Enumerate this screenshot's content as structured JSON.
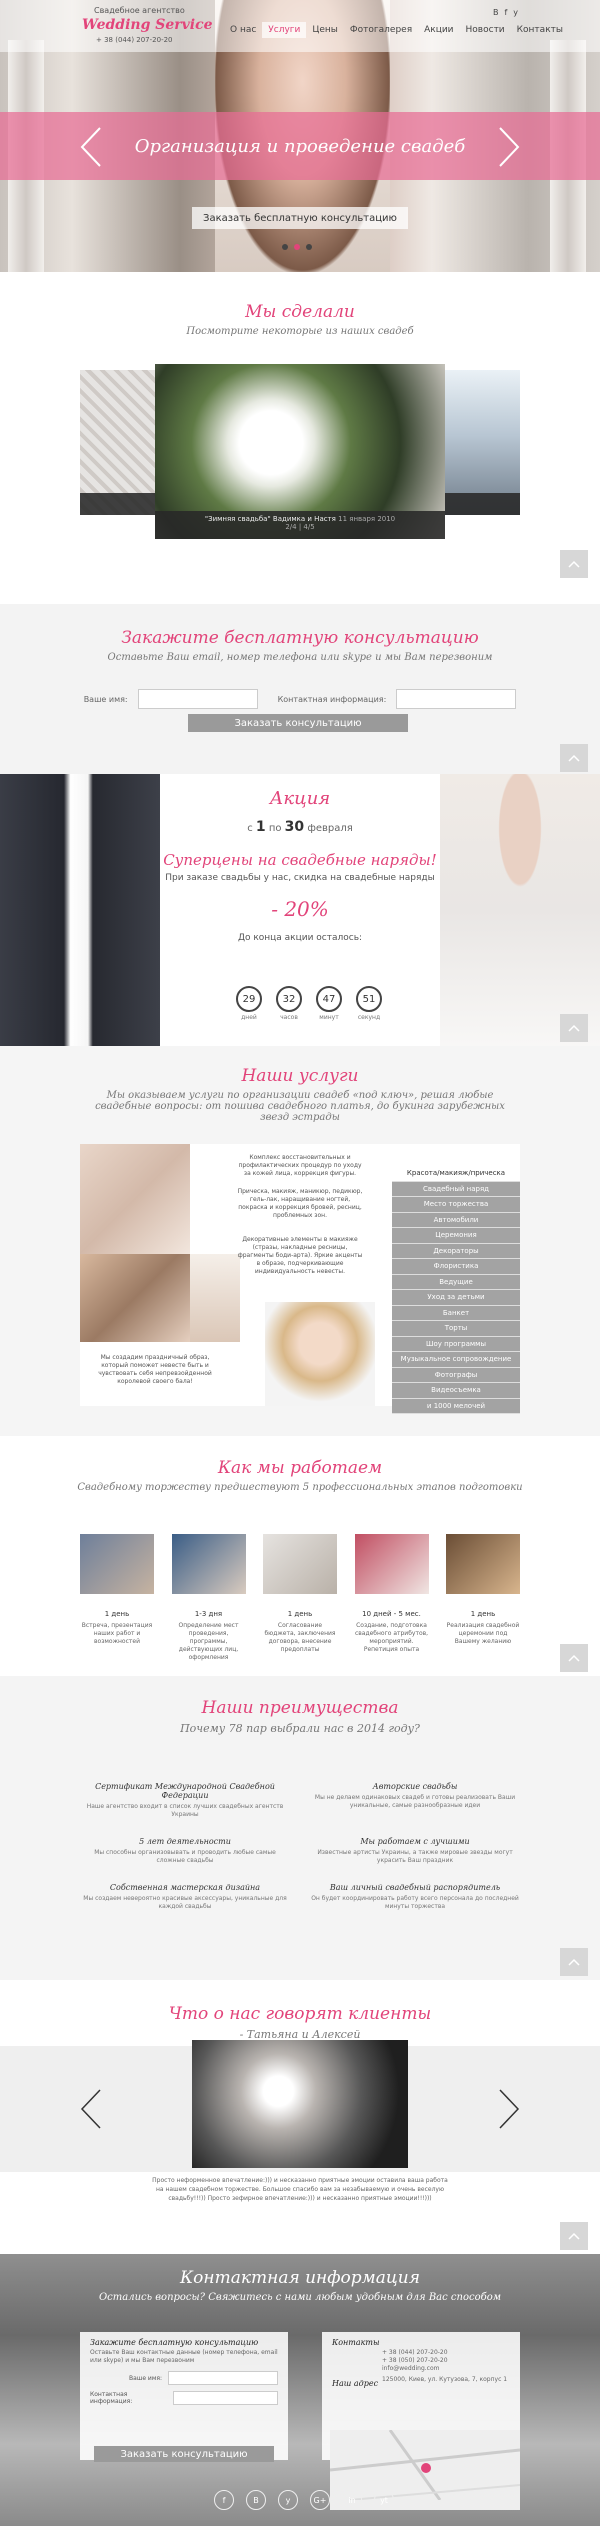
{
  "header": {
    "logo_small": "Свадебное агентство",
    "logo_big": "Wedding Service",
    "phone": "+ 38 (044) 207-20-20",
    "nav": [
      "О нас",
      "Услуги",
      "Цены",
      "Фотогалерея",
      "Акции",
      "Новости",
      "Контакты"
    ],
    "active_nav": "Услуги",
    "social": [
      "B",
      "f",
      "y"
    ]
  },
  "hero": {
    "banner_title": "Организация и проведение свадеб",
    "cta": "Заказать бесплатную консультацию",
    "slides": 3,
    "active_slide": 1
  },
  "portfolio": {
    "title": "Мы сделали",
    "subtitle": "Посмотрите некоторые из наших свадеб",
    "caption": "\"Зимняя свадьба\" Вадимка и Настя",
    "caption_date": "11 января 2010",
    "counter": "2/4 | 4/5"
  },
  "consult": {
    "title": "Закажите бесплатную консультацию",
    "subtitle": "Оставьте Ваш email, номер телефона или skype и мы Вам перезвоним",
    "name_label": "Ваше имя:",
    "contact_label": "Контактная информация:",
    "button": "Заказать консультацию"
  },
  "promo": {
    "title": "Акция",
    "period_prefix": "с",
    "from": "1",
    "period_mid": "по",
    "to": "30",
    "period_suffix": "февраля",
    "headline": "Суперцены на свадебные наряды!",
    "line": "При заказе свадьбы у нас, скидка на свадебные наряды",
    "discount": "- 20%",
    "countdown_label": "До конца акции осталось:",
    "timer": [
      {
        "v": "29",
        "u": "дней"
      },
      {
        "v": "32",
        "u": "часов"
      },
      {
        "v": "47",
        "u": "минут"
      },
      {
        "v": "51",
        "u": "секунд"
      }
    ]
  },
  "services": {
    "title": "Наши услуги",
    "subtitle": "Мы оказываем услуги по организации свадеб «под ключ», решая любые свадебные вопросы: от пошива свадебного платья, до букинга зарубежных звезд эстрады",
    "desc1": "Комплекс восстановительных и профилактических процедур по уходу за кожей лица, коррекция фигуры.",
    "desc2": "Прическа, макияж, маникюр, педикюр, гель-лак, наращивание ногтей, покраска и коррекция бровей, ресниц, проблемных зон.",
    "desc3": "Декоративные элементы в макияже (стразы, накладные ресницы, фрагменты боди-арта). Яркие акценты в образе, подчеркивающие индивидуальность невесты.",
    "desc4": "Мы создадим праздничный образ, который поможет невесте быть и чувствовать себя непревзойденной королевой своего бала!",
    "list_head": "Красота/макияж/прическа",
    "list": [
      "Свадебный наряд",
      "Место торжества",
      "Автомобили",
      "Церемония",
      "Декораторы",
      "Флористика",
      "Ведущие",
      "Уход за детьми",
      "Банкет",
      "Торты",
      "Шоу программы",
      "Музыкальное сопровождение",
      "Фотографы",
      "Видеосъемка",
      "и 1000 мелочей"
    ]
  },
  "how": {
    "title": "Как мы работаем",
    "subtitle": "Свадебному торжеству предшествуют 5 профессиональных этапов подготовки",
    "steps": [
      {
        "day": "1 день",
        "text": "Встреча, презентация наших работ и возможностей"
      },
      {
        "day": "1-3 дня",
        "text": "Определение мест проведения, программы, действующих лиц, оформления"
      },
      {
        "day": "1 день",
        "text": "Согласование бюджета, заключения договора, внесение предоплаты"
      },
      {
        "day": "10 дней - 5 мес.",
        "text": "Создание, подготовка свадебного атрибутов, мероприятий. Репетиция опыта"
      },
      {
        "day": "1 день",
        "text": "Реализация свадебной церемонии под Вашему желанию"
      }
    ]
  },
  "adv": {
    "title": "Наши преимущества",
    "subtitle": "Почему 78 пар выбрали нас в 2014 году?",
    "items": [
      {
        "t": "Сертификат Международной Свадебной Федерации",
        "d": "Наше агентство входит в список лучших свадебных агентств Украины"
      },
      {
        "t": "Авторские свадьбы",
        "d": "Мы не делаем одинаковых свадеб и готовы реализовать Ваши уникальные, самые разнообразные идеи"
      },
      {
        "t": "5 лет деятельности",
        "d": "Мы способны организовывать и проводить любые самые сложные свадьбы"
      },
      {
        "t": "Мы работаем с лучшими",
        "d": "Известные артисты Украины, а также мировые звезды могут украсить Ваш праздник"
      },
      {
        "t": "Собственная мастерская дизайна",
        "d": "Мы создаем невероятно красивые аксессуары, уникальные для каждой свадьбы"
      },
      {
        "t": "Ваш личный свадебный распорядитель",
        "d": "Он будет координировать работу всего персонала до последней минуты торжества"
      }
    ]
  },
  "reviews": {
    "title": "Что о нас говорят клиенты",
    "author": "- Татьяна и Алексей",
    "text": "Просто неформенное впечатление:))) и несказанно приятные эмоции оставила ваша работа на нашем свадебном торжестве. Большое спасибо вам за незабываемую и очень веселую свадьбу!!!)) Просто зефирное впечатление:))) и несказанно приятные эмоции!!!)))"
  },
  "contacts": {
    "title": "Контактная информация",
    "subtitle": "Остались вопросы? Свяжитесь с нами любым удобным для Вас способом",
    "form_title": "Закажите бесплатную консультацию",
    "form_text": "Оставьте Ваш контактные данные (номер телефона, email или skype) и мы Вам перезвоним",
    "name_label": "Ваше имя:",
    "contact_label": "Контактная информация:",
    "button": "Заказать консультацию",
    "info_title": "Контакты",
    "phones": "+ 38 (044) 207-20-20\n+ 38 (050) 207-20-20",
    "email": "info@wedding.com",
    "address_title": "Наш адрес",
    "address": "125000, Киев, ул. Кутузова, 7, корпус 1",
    "social": [
      "f",
      "B",
      "y",
      "G+",
      "in",
      "yt"
    ]
  }
}
